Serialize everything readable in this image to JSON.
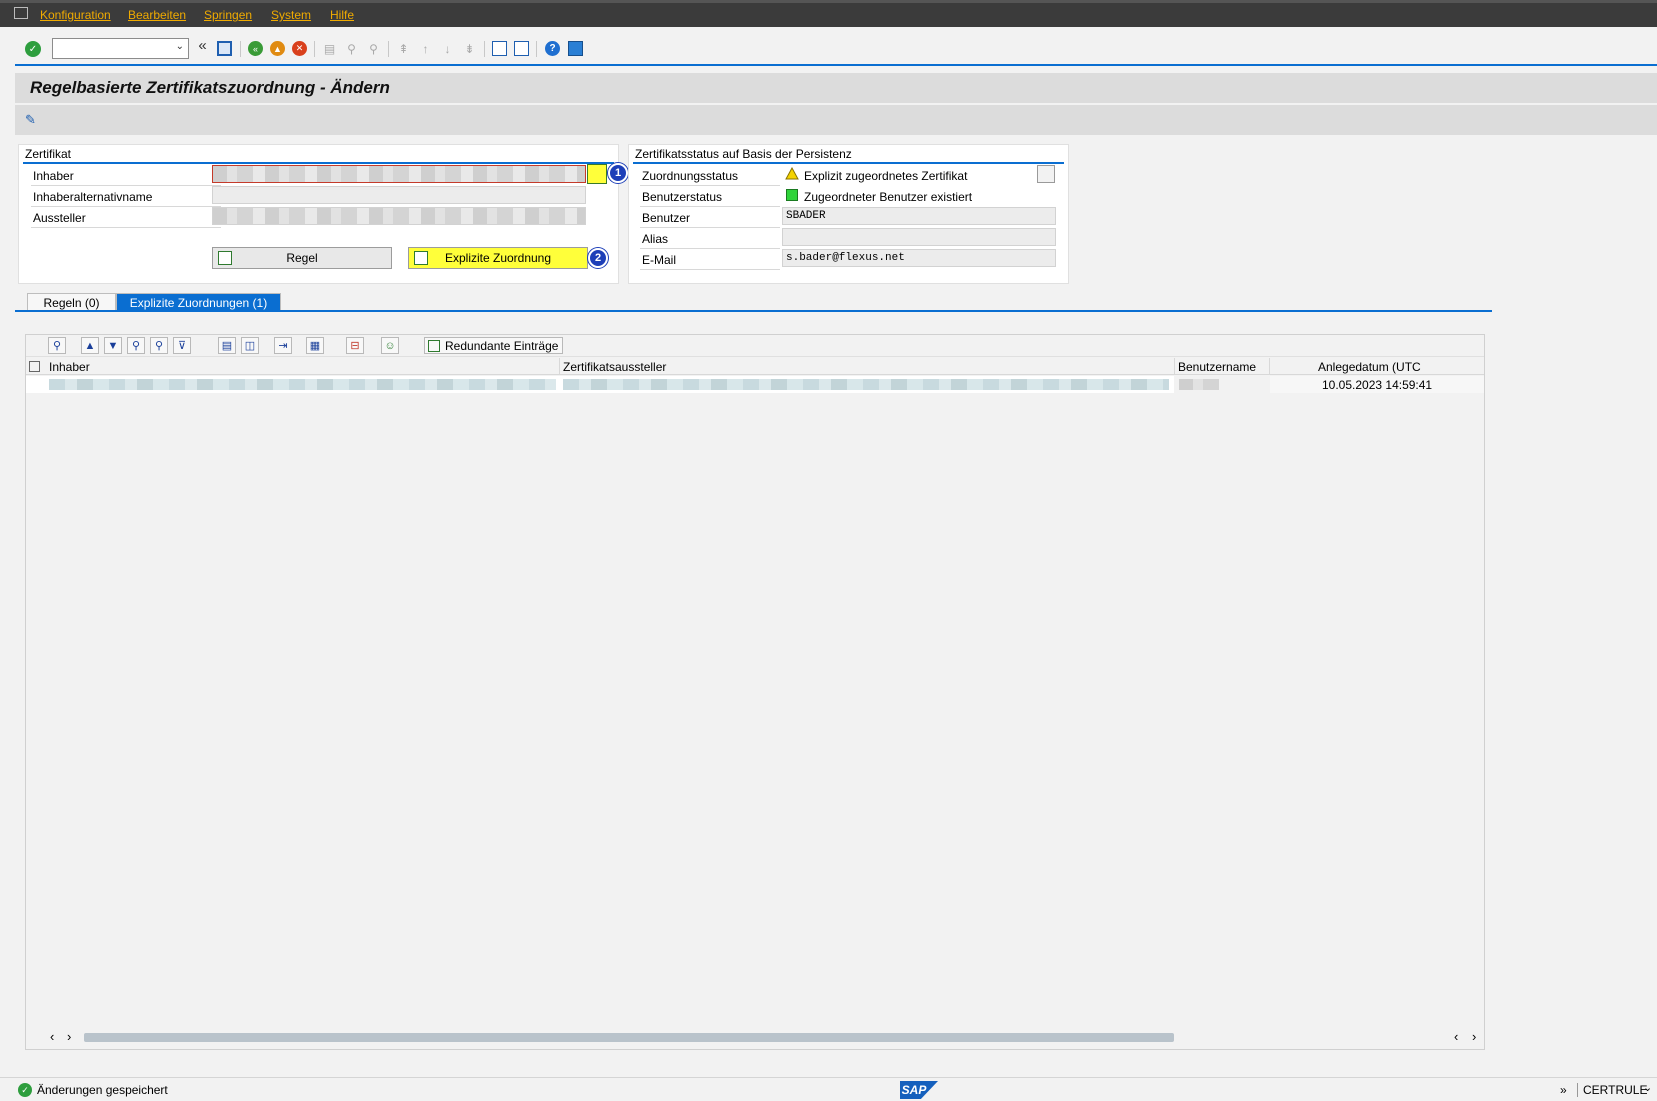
{
  "menu": {
    "items": [
      "Konfiguration",
      "Bearbeiten",
      "Springen",
      "System",
      "Hilfe"
    ]
  },
  "toolbar": {
    "command_field_value": "",
    "icons": [
      "enter-icon",
      "save-icon",
      "back-icon",
      "exit-icon",
      "cancel-icon",
      "print-icon",
      "find-icon",
      "find-next-icon",
      "first-page-icon",
      "previous-page-icon",
      "next-page-icon",
      "last-page-icon",
      "create-session-icon",
      "shortcut-icon",
      "help-icon",
      "customize-layout-icon"
    ]
  },
  "title": "Regelbasierte Zertifikatszuordnung - Ändern",
  "zertifikat": {
    "group_title": "Zertifikat",
    "inhaber_label": "Inhaber",
    "inhaberalternativname_label": "Inhaberalternativname",
    "aussteller_label": "Aussteller",
    "inhaberalternativname_value": "",
    "regel_button": "Regel",
    "explizite_button": "Explizite Zuordnung",
    "badge1": "1",
    "badge2": "2"
  },
  "status": {
    "group_title": "Zertifikatsstatus auf Basis der Persistenz",
    "zuordnungsstatus_label": "Zuordnungsstatus",
    "zuordnungsstatus_value": "Explizit zugeordnetes Zertifikat",
    "benutzerstatus_label": "Benutzerstatus",
    "benutzerstatus_value": "Zugeordneter Benutzer existiert",
    "benutzer_label": "Benutzer",
    "benutzer_value": "SBADER",
    "alias_label": "Alias",
    "alias_value": "",
    "email_label": "E-Mail",
    "email_value": "s.bader@flexus.net",
    "warning_color": "#f5d300",
    "ok_color": "#2fd43a"
  },
  "tabs": [
    {
      "label": "Regeln (0)",
      "active": false
    },
    {
      "label": "Explizite Zuordnungen (1)",
      "active": true
    }
  ],
  "grid": {
    "toolbar_button_label": "Redundante Einträge",
    "columns": [
      "Inhaber",
      "Zertifikatsaussteller",
      "Benutzername",
      "Anlegedatum (UTC"
    ],
    "rows": [
      {
        "anlegedatum": "10.05.2023 14:59:41"
      }
    ]
  },
  "statusbar": {
    "message": "Änderungen gespeichert",
    "logo": "SAP",
    "transaction": "CERTRULE"
  }
}
